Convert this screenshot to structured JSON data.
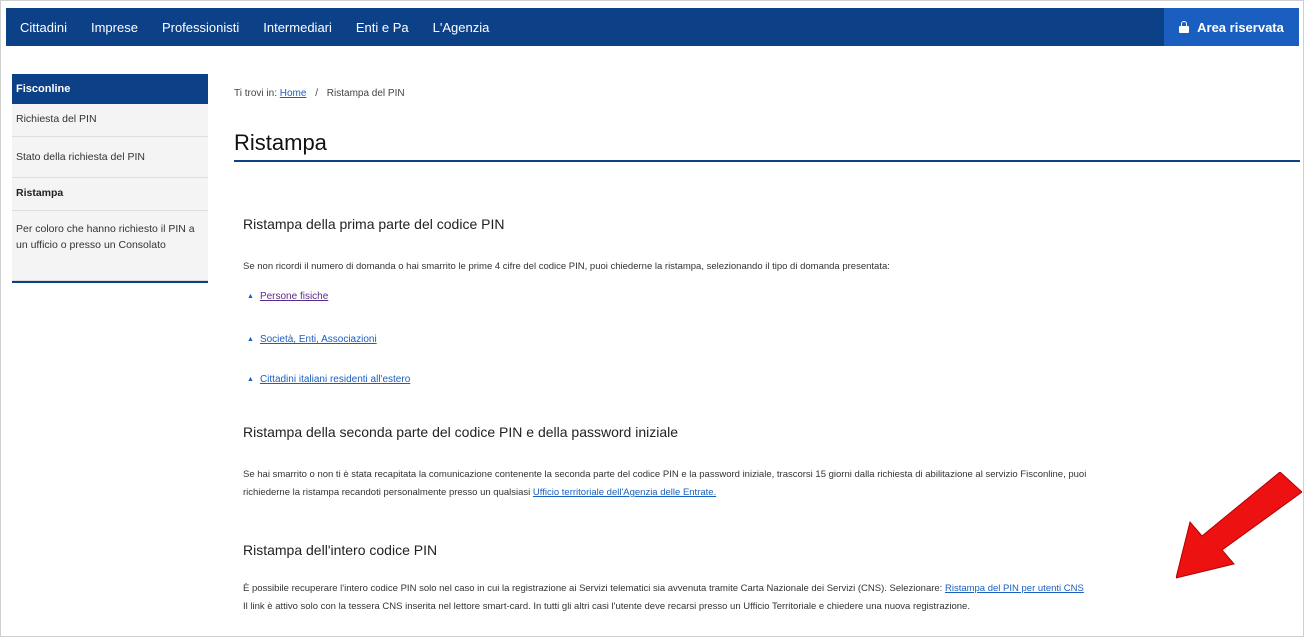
{
  "topnav": {
    "items": [
      "Cittadini",
      "Imprese",
      "Professionisti",
      "Intermediari",
      "Enti e Pa",
      "L'Agenzia"
    ],
    "area_riservata": "Area riservata"
  },
  "sidebar": {
    "header": "Fisconline",
    "items": [
      "Richiesta del PIN",
      "Stato della richiesta del PIN",
      "Ristampa",
      "Per coloro che hanno richiesto il PIN a un ufficio o presso un Consolato"
    ]
  },
  "breadcrumb": {
    "prefix": "Ti trovi in:",
    "home": "Home",
    "separator": "/",
    "current": "Ristampa del PIN"
  },
  "page_title": "Ristampa",
  "section1": {
    "heading": "Ristampa della prima parte del codice PIN",
    "text": "Se non ricordi il numero di domanda o hai smarrito le prime 4 cifre del codice PIN, puoi chiederne la ristampa, selezionando il tipo di domanda presentata:",
    "links": [
      "Persone fisiche",
      "Società, Enti, Associazioni",
      "Cittadini italiani residenti all'estero"
    ]
  },
  "section2": {
    "heading": "Ristampa della seconda parte del codice PIN e della password iniziale",
    "text_line1": "Se hai smarrito o non ti è stata recapitata la comunicazione contenente la seconda parte del codice PIN e la password iniziale, trascorsi 15 giorni dalla richiesta di abilitazione al servizio Fisconline, puoi",
    "text_line2_prefix": "richiederne la ristampa recandoti personalmente presso un qualsiasi",
    "text_link": "Ufficio territoriale dell'Agenzia delle Entrate."
  },
  "section3": {
    "heading": "Ristampa dell'intero codice PIN",
    "text_line1_prefix": "È possibile recuperare l'intero codice PIN solo nel caso in cui la registrazione ai Servizi telematici sia avvenuta tramite Carta Nazionale dei Servizi (CNS). Selezionare:",
    "text_link": "Ristampa del PIN per utenti CNS",
    "text_line2": "Il link è attivo solo con la tessera CNS inserita nel lettore smart-card. In tutti gli altri casi l'utente deve recarsi presso un Ufficio Territoriale e chiedere una nuova registrazione."
  },
  "colors": {
    "nav_bg": "#0c4087",
    "area_bg": "#1a5fc0",
    "link": "#1a5fc0",
    "arrow": "#ee1111"
  }
}
